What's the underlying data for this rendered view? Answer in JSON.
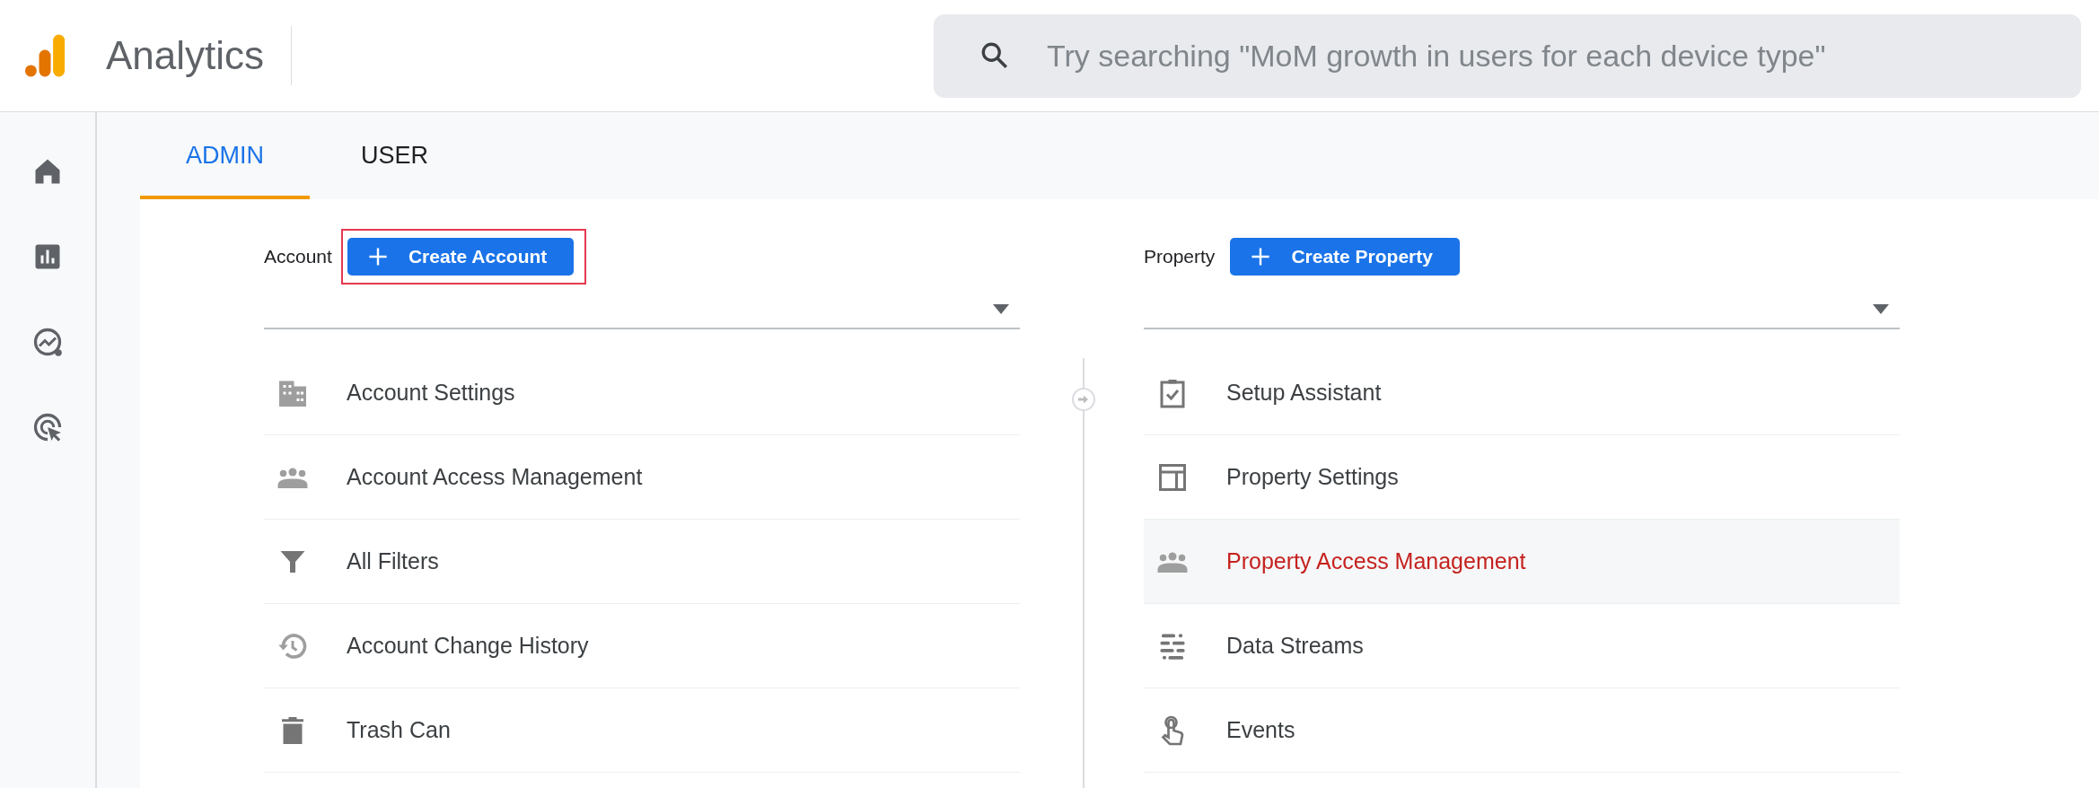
{
  "header": {
    "app_name": "Analytics",
    "search": {
      "placeholder": "Try searching \"MoM growth in users for each device type\""
    }
  },
  "tabs": [
    {
      "label": "ADMIN",
      "selected": true
    },
    {
      "label": "USER",
      "selected": false
    }
  ],
  "columns": [
    {
      "label": "Account",
      "button": {
        "label": "Create Account",
        "highlighted": true
      },
      "items": [
        {
          "label": "Account Settings",
          "selected": false
        },
        {
          "label": "Account Access Management",
          "selected": false
        },
        {
          "label": "All Filters",
          "selected": false
        },
        {
          "label": "Account Change History",
          "selected": false
        },
        {
          "label": "Trash Can",
          "selected": false
        }
      ]
    },
    {
      "label": "Property",
      "button": {
        "label": "Create Property",
        "highlighted": false
      },
      "items": [
        {
          "label": "Setup Assistant",
          "selected": false
        },
        {
          "label": "Property Settings",
          "selected": false
        },
        {
          "label": "Property Access Management",
          "selected": true
        },
        {
          "label": "Data Streams",
          "selected": false
        },
        {
          "label": "Events",
          "selected": false
        }
      ]
    }
  ]
}
